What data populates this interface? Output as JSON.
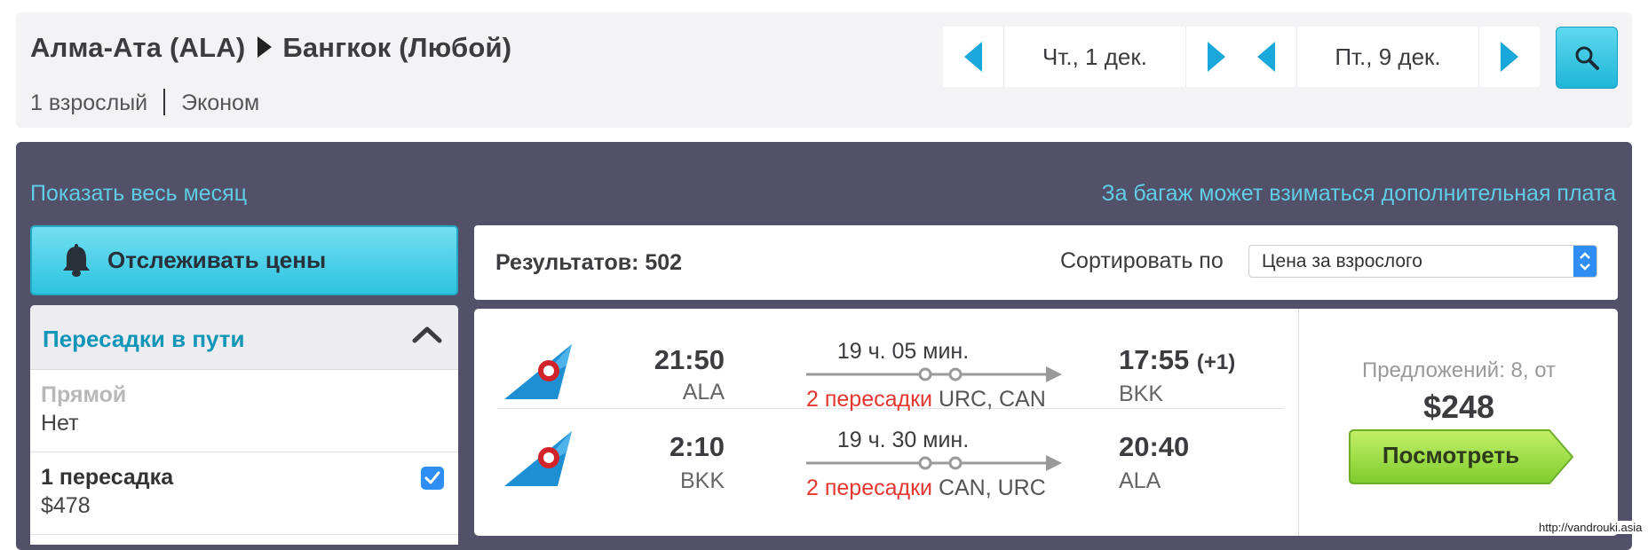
{
  "search": {
    "origin": "Алма-Ата (ALA)",
    "destination": "Бангкок (Любой)",
    "passengers": "1 взрослый",
    "cabin": "Эконом",
    "depart_date": "Чт., 1 дек.",
    "return_date": "Пт., 9 дек.",
    "search_icon": "search-icon"
  },
  "links": {
    "show_month": "Показать весь месяц",
    "baggage_note": "За багаж может взиматься дополнительная плата"
  },
  "track_prices": {
    "label": "Отслеживать цены",
    "icon": "bell-icon"
  },
  "filters": {
    "stops_title": "Пересадки в пути",
    "options": [
      {
        "name": "Прямой",
        "value": "Нет",
        "enabled": false,
        "checked": false
      },
      {
        "name": "1 пересадка",
        "value": "$478",
        "enabled": true,
        "checked": true
      }
    ]
  },
  "results": {
    "count_label": "Результатов: 502",
    "sort_label": "Сортировать по",
    "sort_value": "Цена за взрослого"
  },
  "flights": [
    {
      "outbound": {
        "dep_time": "21:50",
        "dep_code": "ALA",
        "duration": "19 ч. 05 мин.",
        "stops": "2 пересадки",
        "stop_cities": "URC, CAN",
        "arr_time": "17:55",
        "arr_plus": "(+1)",
        "arr_code": "BKK"
      },
      "inbound": {
        "dep_time": "2:10",
        "dep_code": "BKK",
        "duration": "19 ч. 30 мин.",
        "stops": "2 пересадки",
        "stop_cities": "CAN, URC",
        "arr_time": "20:40",
        "arr_code": "ALA"
      },
      "offers": "Предложений: 8, от",
      "price": "$248",
      "button": "Посмотреть"
    }
  ],
  "watermark": "http://vandrouki.asia",
  "colors": {
    "accent": "#1aa7d9",
    "panel": "#53506a",
    "stops_red": "#e5362f",
    "button_green": "#8bd63a"
  }
}
